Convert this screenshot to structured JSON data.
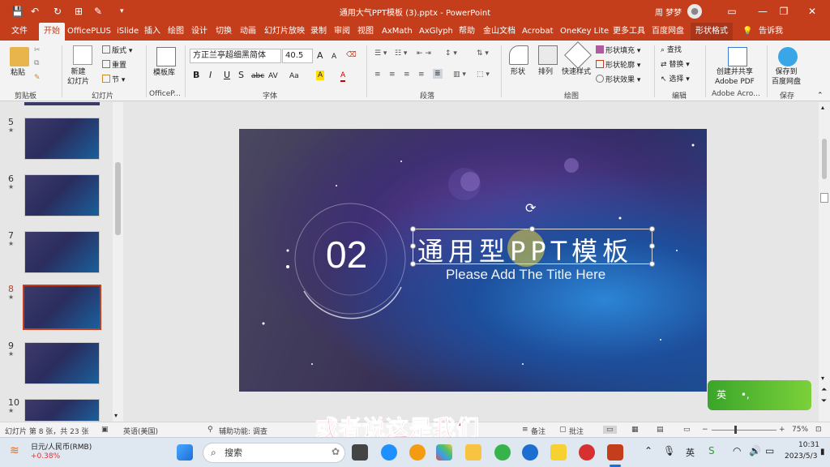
{
  "window": {
    "title": "通用大气PPT模板 (3).pptx  -  PowerPoint",
    "user": "周 梦梦",
    "colors": {
      "accent": "#c43e1c",
      "ime_green": "#4caf2d",
      "caption": "#e8335a"
    }
  },
  "tabs": [
    "文件",
    "开始",
    "OfficePLUS",
    "iSlide",
    "插入",
    "绘图",
    "设计",
    "切换",
    "动画",
    "幻灯片放映",
    "录制",
    "审阅",
    "视图",
    "AxMath",
    "AxGlyph",
    "帮助",
    "金山文档",
    "Acrobat",
    "OneKey Lite",
    "更多工具",
    "百度网盘",
    "形状格式"
  ],
  "tell_me": "告诉我",
  "ribbon": {
    "clipboard": {
      "paste": "粘贴",
      "label": "剪贴板"
    },
    "slides": {
      "new_slide": "新建\n幻灯片",
      "layout": "版式",
      "reset": "重置",
      "section": "节",
      "label": "幻灯片"
    },
    "officeplus": {
      "library": "模板库",
      "label": "OfficeP..."
    },
    "font": {
      "name": "方正兰亭超细黑简体",
      "size": "40.5",
      "grow": "A",
      "shrink": "A",
      "bold": "B",
      "italic": "I",
      "underline": "U",
      "shadow": "S",
      "strike": "abc",
      "spacing": "AV",
      "case": "Aa",
      "highlight": "A",
      "color": "A",
      "label": "字体"
    },
    "paragraph": {
      "label": "段落"
    },
    "drawing": {
      "shapes": "形状",
      "arrange": "排列",
      "quick_styles": "快速样式",
      "fill": "形状填充",
      "outline": "形状轮廓",
      "effects": "形状效果",
      "label": "绘图"
    },
    "editing": {
      "find": "查找",
      "replace": "替换",
      "select": "选择",
      "label": "编辑"
    },
    "acrobat": {
      "create_share": "创建并共享\nAdobe PDF",
      "label": "Adobe Acro..."
    },
    "save": {
      "save_baidu": "保存到\n百度网盘",
      "label": "保存"
    }
  },
  "thumbnails": [
    {
      "num": "5",
      "star": "★"
    },
    {
      "num": "6",
      "star": "★"
    },
    {
      "num": "7",
      "star": "★"
    },
    {
      "num": "8",
      "star": "★",
      "selected": true
    },
    {
      "num": "9",
      "star": "★"
    },
    {
      "num": "10",
      "star": "★"
    }
  ],
  "slide": {
    "number": "02",
    "title": "通用型PPT模板",
    "subtitle": "Please Add The Title Here"
  },
  "ime": {
    "label": "英",
    "punct": "•,"
  },
  "statusbar": {
    "slide_info": "幻灯片 第 8 张，共 23 张",
    "language": "英语(美国)",
    "accessibility": "辅助功能: 调查",
    "notes": "备注",
    "comments": "批注",
    "zoom": "75%"
  },
  "caption": "或者说这是我们",
  "taskbar": {
    "stock_name": "日元/人民币(RMB)",
    "stock_change": "+0.38%",
    "search": "搜索",
    "ime": "英",
    "time": "10:31",
    "date": "2023/5/3"
  }
}
